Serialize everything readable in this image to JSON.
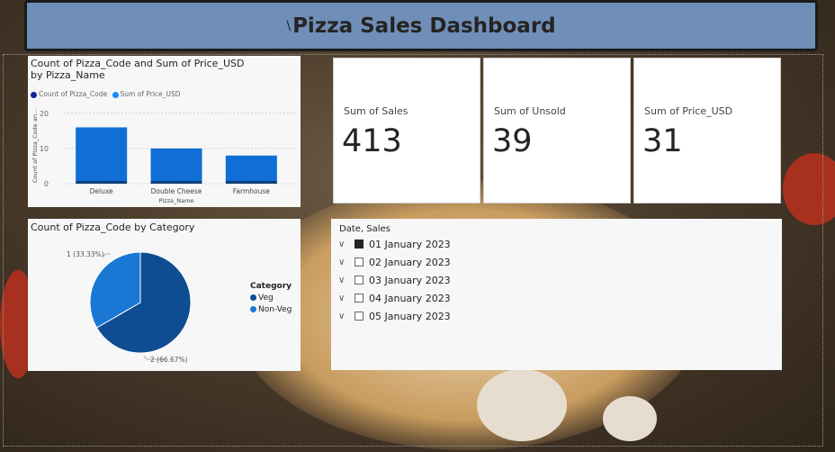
{
  "dashboard": {
    "title": "Pizza Sales Dashboard",
    "title_mark": "\\"
  },
  "bar_visual": {
    "title": "Count of Pizza_Code and Sum of Price_USD by Pizza_Name",
    "legend": [
      "Count of Pizza_Code",
      "Sum of Price_USD"
    ],
    "ylabel": "Count of Pizza_Code an...",
    "xlabel": "Pizza_Name",
    "yticks": [
      "20",
      "10",
      "0"
    ]
  },
  "chart_data": [
    {
      "type": "bar",
      "title": "Count of Pizza_Code and Sum of Price_USD by Pizza_Name",
      "xlabel": "Pizza_Name",
      "ylabel": "Count of Pizza_Code an...",
      "categories": [
        "Deluxe",
        "Double Cheese",
        "Farmhouse"
      ],
      "series": [
        {
          "name": "Count of Pizza_Code",
          "values": [
            1,
            1,
            1
          ],
          "color": "#12239e"
        },
        {
          "name": "Sum of Price_USD",
          "values": [
            16,
            10,
            8
          ],
          "color": "#118dff"
        }
      ],
      "ylim": [
        0,
        22
      ],
      "legend_position": "top-left"
    },
    {
      "type": "pie",
      "title": "Count of Pizza_Code by Category",
      "legend_title": "Category",
      "slices": [
        {
          "name": "Veg",
          "value": 2,
          "label": "2 (66.67%)",
          "color": "#0e4d92"
        },
        {
          "name": "Non-Veg",
          "value": 1,
          "label": "1 (33.33%)",
          "color": "#1a78d4"
        }
      ]
    }
  ],
  "pie_visual": {
    "title": "Count of Pizza_Code by Category",
    "legend_title": "Category",
    "legend": [
      "Veg",
      "Non-Veg"
    ]
  },
  "kpis": [
    {
      "label": "Sum of Sales",
      "value": "413"
    },
    {
      "label": "Sum of Unsold",
      "value": "39"
    },
    {
      "label": "Sum of Price_USD",
      "value": "31"
    }
  ],
  "slicer": {
    "title": "Date, Sales",
    "items": [
      "01 January 2023",
      "02 January 2023",
      "03 January 2023",
      "04 January 2023",
      "05 January 2023"
    ],
    "checked_index": 0
  },
  "colors": {
    "title_bar": "#6f8fb8",
    "bar": "#0f6fd6",
    "bar_dark": "#0d3f7a",
    "pie_veg": "#0e4d92",
    "pie_nonveg": "#1a78d4"
  }
}
